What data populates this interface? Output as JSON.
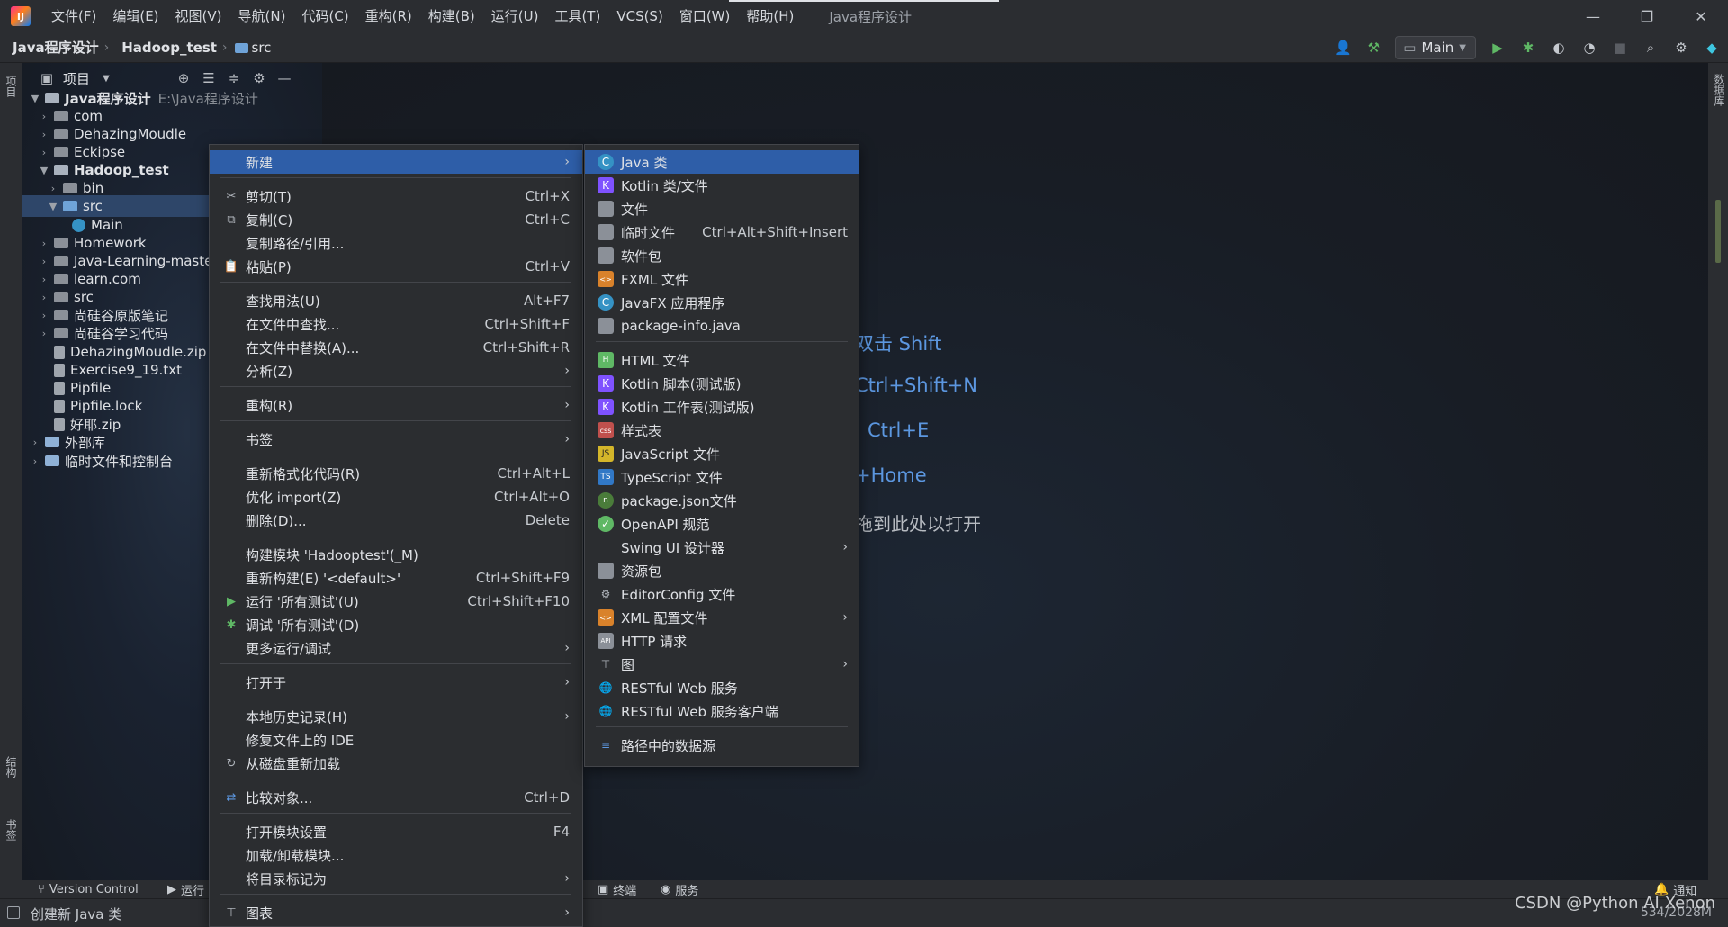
{
  "titlebar": {
    "menus": [
      "文件(F)",
      "编辑(E)",
      "视图(V)",
      "导航(N)",
      "代码(C)",
      "重构(R)",
      "构建(B)",
      "运行(U)",
      "工具(T)",
      "VCS(S)",
      "窗口(W)",
      "帮助(H)"
    ],
    "window_title": "Java程序设计",
    "logo_text": "IJ",
    "controls": {
      "minimize": "—",
      "restore": "❐",
      "close": "✕"
    }
  },
  "navbar": {
    "crumbs": [
      "Java程序设计",
      "Hadoop_test",
      "src"
    ],
    "separator": "›",
    "run_config": "Main"
  },
  "left_strip": {
    "project": "项目",
    "structure": "结构",
    "bookmarks": "书签"
  },
  "right_strip": {
    "database": "数据库"
  },
  "project_panel": {
    "title": "项目",
    "tree": [
      {
        "label": "Java程序设计",
        "path": "E:\\Java程序设计"
      },
      {
        "label": "com"
      },
      {
        "label": "DehazingMoudle"
      },
      {
        "label": "Eckipse"
      },
      {
        "label": "Hadoop_test"
      },
      {
        "label": "bin"
      },
      {
        "label": "src"
      },
      {
        "label": "Main"
      },
      {
        "label": "Homework"
      },
      {
        "label": "Java-Learning-maste"
      },
      {
        "label": "learn.com"
      },
      {
        "label": "src"
      },
      {
        "label": "尚硅谷原版笔记"
      },
      {
        "label": "尚硅谷学习代码"
      },
      {
        "label": "DehazingMoudle.zip"
      },
      {
        "label": "Exercise9_19.txt"
      },
      {
        "label": "Pipfile"
      },
      {
        "label": "Pipfile.lock"
      },
      {
        "label": "好耶.zip"
      },
      {
        "label": "外部库"
      },
      {
        "label": "临时文件和控制台"
      }
    ]
  },
  "editor_hints": [
    "双击 Shift",
    "Ctrl+Shift+N",
    "Ctrl+E",
    "+Home",
    "拖到此处以打开"
  ],
  "context_menu": {
    "items": [
      {
        "label": "新建",
        "shortcut": "",
        "submenu": true
      },
      {
        "label": "剪切(T)",
        "shortcut": "Ctrl+X"
      },
      {
        "label": "复制(C)",
        "shortcut": "Ctrl+C"
      },
      {
        "label": "复制路径/引用...",
        "shortcut": ""
      },
      {
        "label": "粘贴(P)",
        "shortcut": "Ctrl+V"
      },
      {
        "label": "查找用法(U)",
        "shortcut": "Alt+F7"
      },
      {
        "label": "在文件中查找...",
        "shortcut": "Ctrl+Shift+F"
      },
      {
        "label": "在文件中替换(A)...",
        "shortcut": "Ctrl+Shift+R"
      },
      {
        "label": "分析(Z)",
        "shortcut": "",
        "submenu": true
      },
      {
        "label": "重构(R)",
        "shortcut": "",
        "submenu": true
      },
      {
        "label": "书签",
        "shortcut": "",
        "submenu": true
      },
      {
        "label": "重新格式化代码(R)",
        "shortcut": "Ctrl+Alt+L"
      },
      {
        "label": "优化 import(Z)",
        "shortcut": "Ctrl+Alt+O"
      },
      {
        "label": "删除(D)...",
        "shortcut": "Delete"
      },
      {
        "label": "构建模块 'Hadooptest'(_M)",
        "shortcut": ""
      },
      {
        "label": "重新构建(E) '<default>'",
        "shortcut": "Ctrl+Shift+F9"
      },
      {
        "label": "运行 '所有测试'(U)",
        "shortcut": "Ctrl+Shift+F10"
      },
      {
        "label": "调试 '所有测试'(D)",
        "shortcut": ""
      },
      {
        "label": "更多运行/调试",
        "shortcut": "",
        "submenu": true
      },
      {
        "label": "打开于",
        "shortcut": "",
        "submenu": true
      },
      {
        "label": "本地历史记录(H)",
        "shortcut": "",
        "submenu": true
      },
      {
        "label": "修复文件上的 IDE",
        "shortcut": ""
      },
      {
        "label": "从磁盘重新加载",
        "shortcut": ""
      },
      {
        "label": "比较对象...",
        "shortcut": "Ctrl+D"
      },
      {
        "label": "打开模块设置",
        "shortcut": "F4"
      },
      {
        "label": "加载/卸载模块...",
        "shortcut": ""
      },
      {
        "label": "将目录标记为",
        "shortcut": "",
        "submenu": true
      },
      {
        "label": "图表",
        "shortcut": "",
        "submenu": true
      }
    ]
  },
  "new_menu": {
    "items": [
      {
        "label": "Java 类",
        "shortcut": ""
      },
      {
        "label": "Kotlin 类/文件",
        "shortcut": ""
      },
      {
        "label": "文件",
        "shortcut": ""
      },
      {
        "label": "临时文件",
        "shortcut": "Ctrl+Alt+Shift+Insert"
      },
      {
        "label": "软件包",
        "shortcut": ""
      },
      {
        "label": "FXML 文件",
        "shortcut": ""
      },
      {
        "label": "JavaFX 应用程序",
        "shortcut": ""
      },
      {
        "label": "package-info.java",
        "shortcut": ""
      },
      {
        "label": "HTML 文件",
        "shortcut": ""
      },
      {
        "label": "Kotlin 脚本(测试版)",
        "shortcut": ""
      },
      {
        "label": "Kotlin 工作表(测试版)",
        "shortcut": ""
      },
      {
        "label": "样式表",
        "shortcut": ""
      },
      {
        "label": "JavaScript 文件",
        "shortcut": ""
      },
      {
        "label": "TypeScript 文件",
        "shortcut": ""
      },
      {
        "label": "package.json文件",
        "shortcut": ""
      },
      {
        "label": "OpenAPI 规范",
        "shortcut": ""
      },
      {
        "label": "Swing UI 设计器",
        "shortcut": "",
        "submenu": true
      },
      {
        "label": "资源包",
        "shortcut": ""
      },
      {
        "label": "EditorConfig 文件",
        "shortcut": ""
      },
      {
        "label": "XML 配置文件",
        "shortcut": "",
        "submenu": true
      },
      {
        "label": "HTTP 请求",
        "shortcut": ""
      },
      {
        "label": "图",
        "shortcut": "",
        "submenu": true
      },
      {
        "label": "RESTful Web 服务",
        "shortcut": ""
      },
      {
        "label": "RESTful Web 服务客户端",
        "shortcut": ""
      },
      {
        "label": "路径中的数据源",
        "shortcut": ""
      }
    ]
  },
  "bottom_bar": {
    "version_control": "Version Control",
    "run": "运行",
    "terminal": "终端",
    "services": "服务",
    "notifications": "通知"
  },
  "status_bar": {
    "message": "创建新 Java 类",
    "memory": "534/2028M",
    "watermark": "CSDN @Python AI Xenon"
  },
  "colors": {
    "menu_highlight": "#2e5ea8",
    "selection": "#2e4669",
    "hint_blue": "#5c97e0"
  }
}
